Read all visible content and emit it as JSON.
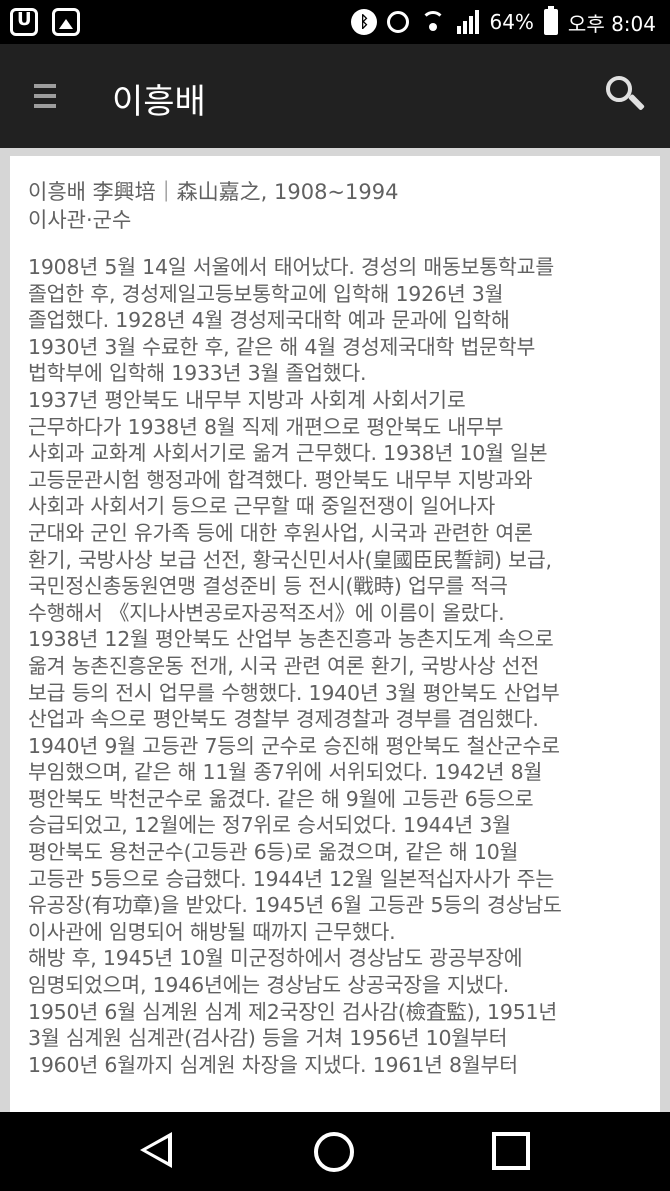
{
  "status_bar": {
    "battery_percent": "64%",
    "time": "오후 8:04"
  },
  "app_bar": {
    "title": "이흥배"
  },
  "article": {
    "heading": "이흥배 李興培｜森山嘉之, 1908~1994",
    "subheading": "이사관·군수",
    "lines": [
      "1908년 5월 14일 서울에서 태어났다. 경성의 매동보통학교를",
      "졸업한 후, 경성제일고등보통학교에 입학해 1926년 3월",
      "졸업했다. 1928년 4월 경성제국대학 예과 문과에 입학해",
      "1930년 3월 수료한 후, 같은 해 4월 경성제국대학 법문학부",
      "법학부에 입학해 1933년 3월 졸업했다.",
      "1937년 평안북도 내무부 지방과 사회계 사회서기로",
      "근무하다가 1938년 8월 직제 개편으로 평안북도 내무부",
      "사회과 교화계 사회서기로 옮겨 근무했다. 1938년 10월 일본",
      "고등문관시험 행정과에 합격했다. 평안북도 내무부 지방과와",
      "사회과 사회서기 등으로 근무할 때 중일전쟁이 일어나자",
      "군대와 군인 유가족 등에 대한 후원사업, 시국과 관련한 여론",
      "환기, 국방사상 보급 선전, 황국신민서사(皇國臣民誓詞) 보급,",
      "국민정신총동원연맹 결성준비 등 전시(戰時) 업무를 적극",
      "수행해서 《지나사변공로자공적조서》에 이름이 올랐다.",
      "1938년 12월 평안북도 산업부 농촌진흥과 농촌지도계 속으로",
      "옮겨 농촌진흥운동 전개, 시국 관련 여론 환기, 국방사상 선전",
      "보급 등의 전시 업무를 수행했다. 1940년 3월 평안북도 산업부",
      "산업과 속으로 평안북도 경찰부 경제경찰과 경부를 겸임했다.",
      "1940년 9월 고등관 7등의 군수로 승진해 평안북도 철산군수로",
      "부임했으며, 같은 해 11월 종7위에 서위되었다. 1942년 8월",
      "평안북도 박천군수로 옮겼다. 같은 해 9월에 고등관 6등으로",
      "승급되었고, 12월에는 정7위로 승서되었다. 1944년 3월",
      "평안북도 용천군수(고등관 6등)로 옮겼으며, 같은 해 10월",
      "고등관 5등으로 승급했다. 1944년 12월 일본적십자사가 주는",
      "유공장(有功章)을 받았다. 1945년 6월 고등관 5등의 경상남도",
      "이사관에 임명되어 해방될 때까지 근무했다.",
      "해방 후, 1945년 10월 미군정하에서 경상남도 광공부장에",
      "임명되었으며, 1946년에는 경상남도 상공국장을 지냈다.",
      "1950년 6월 심계원 심계 제2국장인 검사감(檢査監), 1951년",
      "3월 심계원 심계관(검사감) 등을 거쳐 1956년 10월부터",
      "1960년 6월까지 심계원 차장을 지냈다. 1961년 8월부터"
    ]
  }
}
